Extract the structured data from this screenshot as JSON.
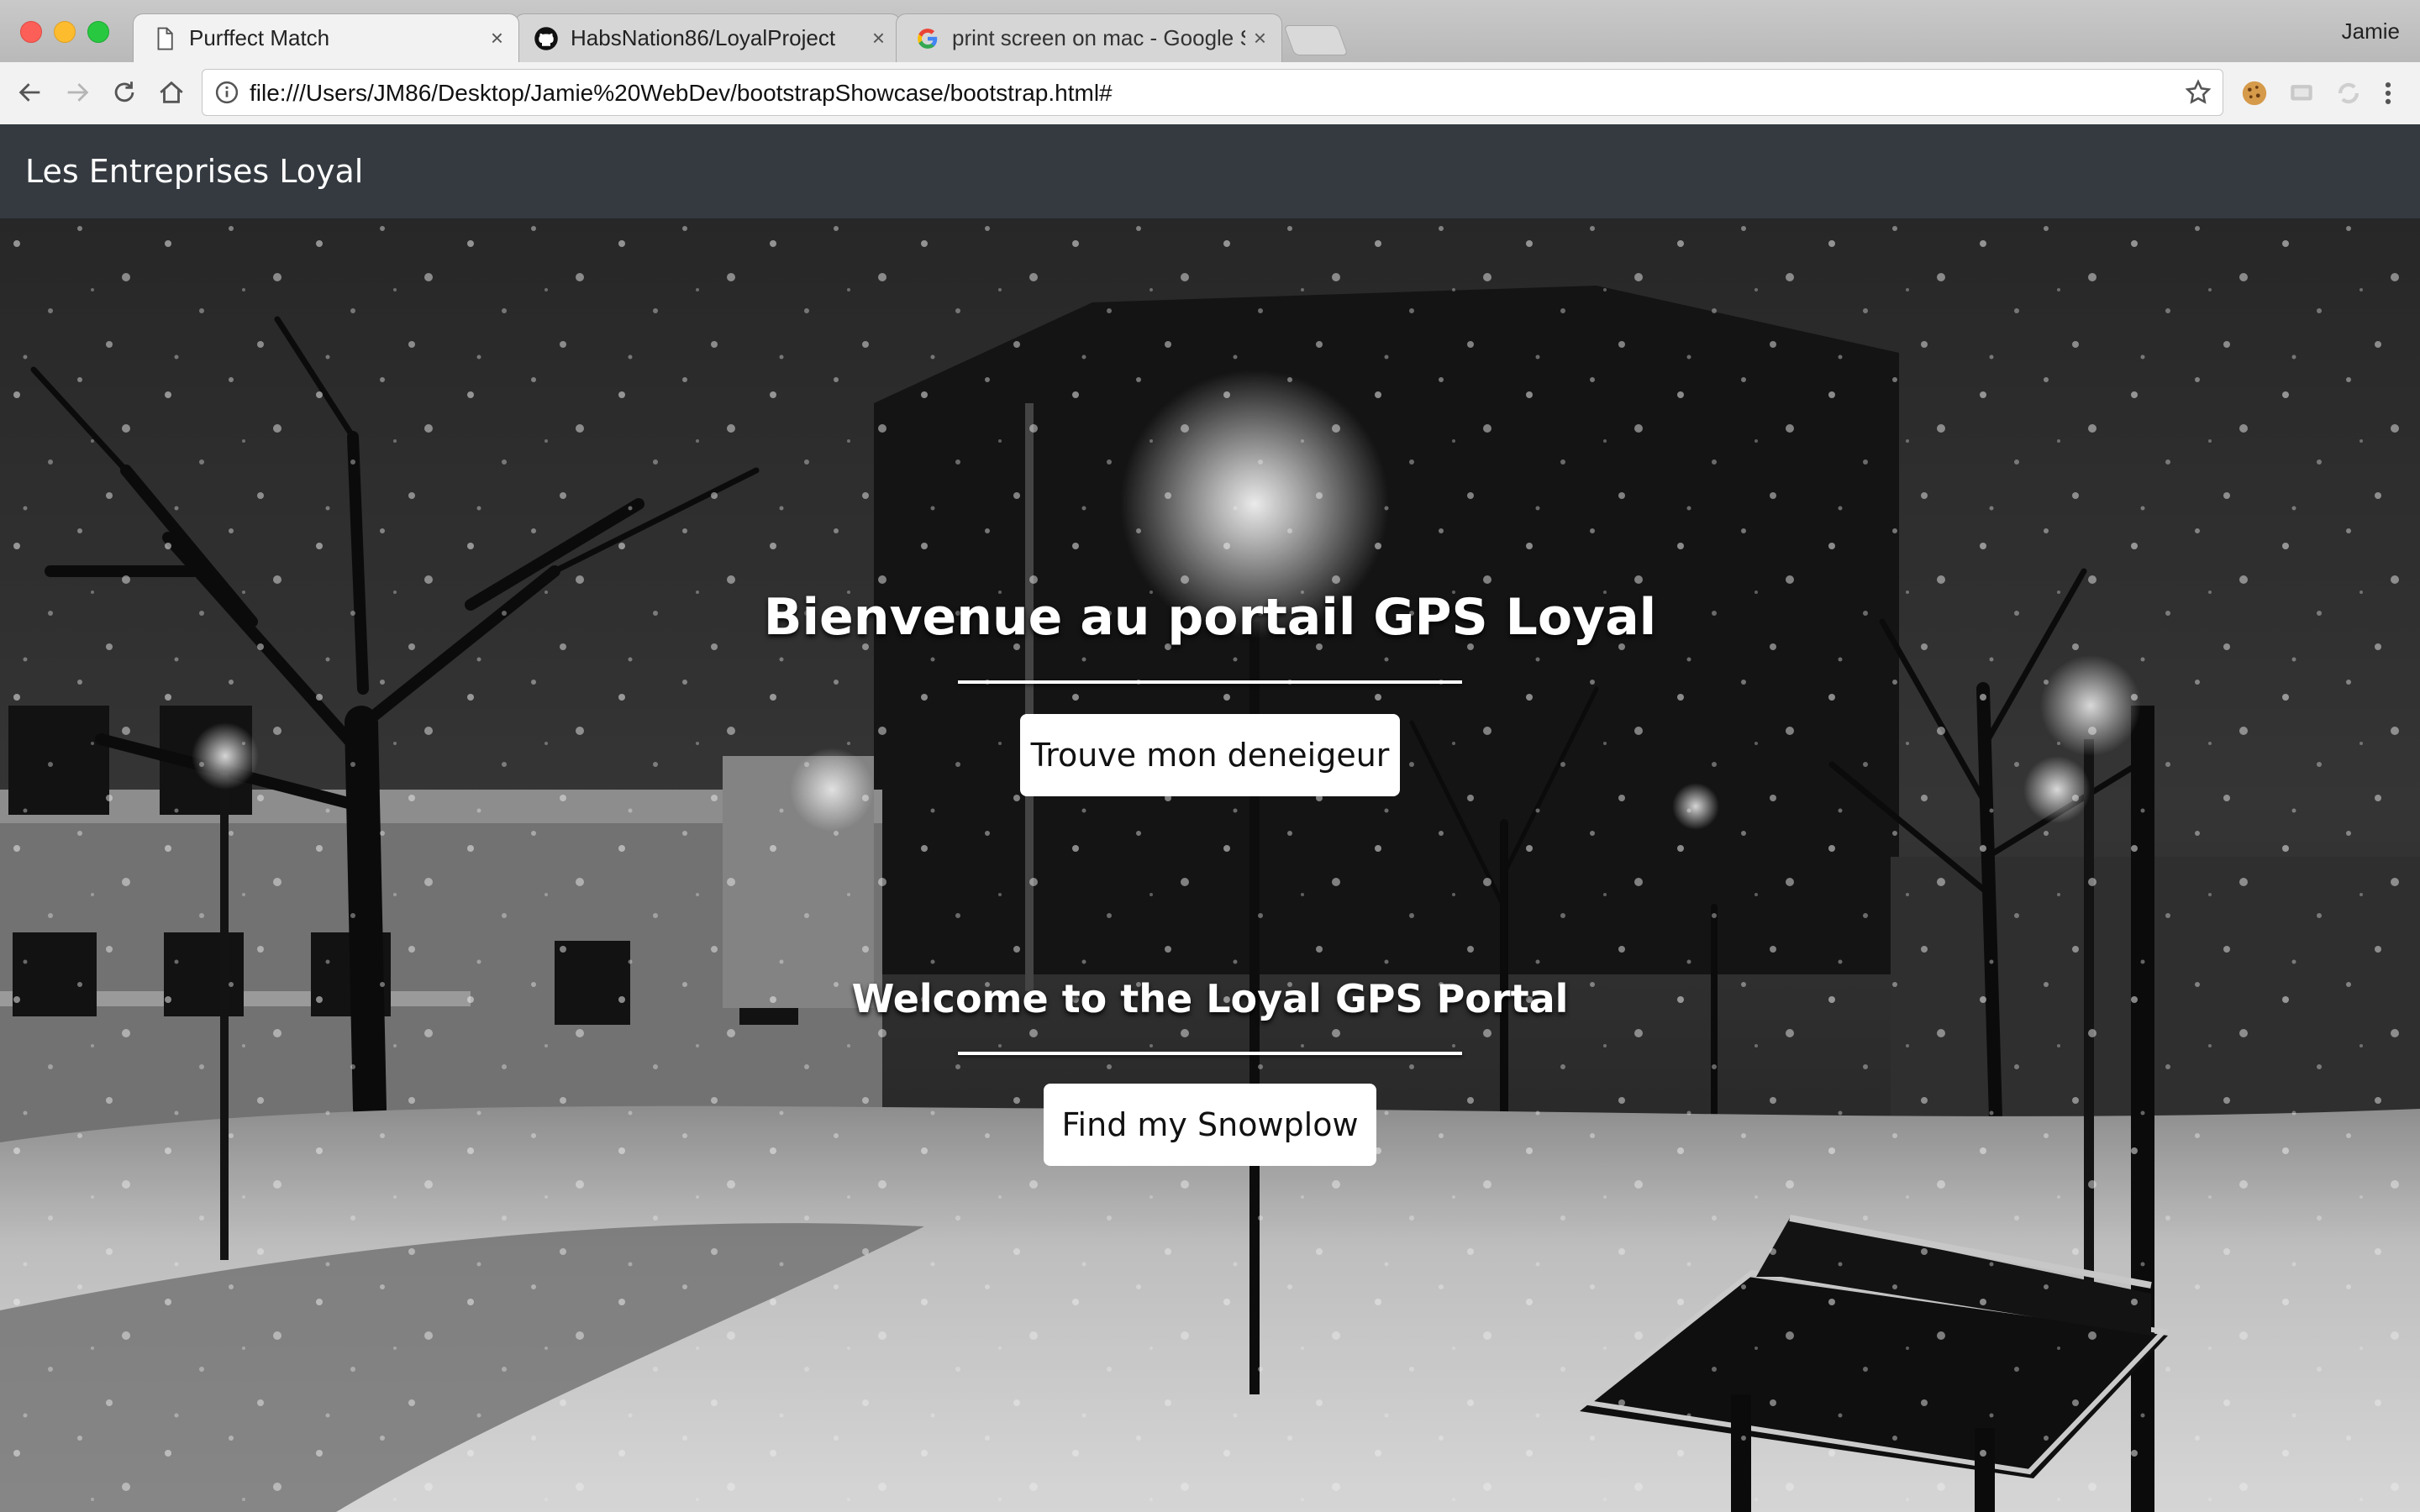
{
  "browser": {
    "tabs": [
      {
        "title": "Purffect Match",
        "icon": "document-icon",
        "active": true
      },
      {
        "title": "HabsNation86/LoyalProject",
        "icon": "github-icon",
        "active": false
      },
      {
        "title": "print screen on mac - Google S",
        "icon": "google-icon",
        "active": false
      }
    ],
    "close_glyph": "×",
    "profile_name": "Jamie",
    "url": "file:///Users/JM86/Desktop/Jamie%20WebDev/bootstrapShowcase/bootstrap.html#"
  },
  "navbar": {
    "brand": "Les Entreprises Loyal",
    "background": "#343a40"
  },
  "hero": {
    "heading_fr": "Bienvenue au portail GPS Loyal",
    "button_fr": "Trouve mon deneigeur",
    "heading_en": "Welcome to the Loyal GPS Portal",
    "button_en": "Find my Snowplow",
    "background_description_icon": "snowy-park-night-photo"
  }
}
